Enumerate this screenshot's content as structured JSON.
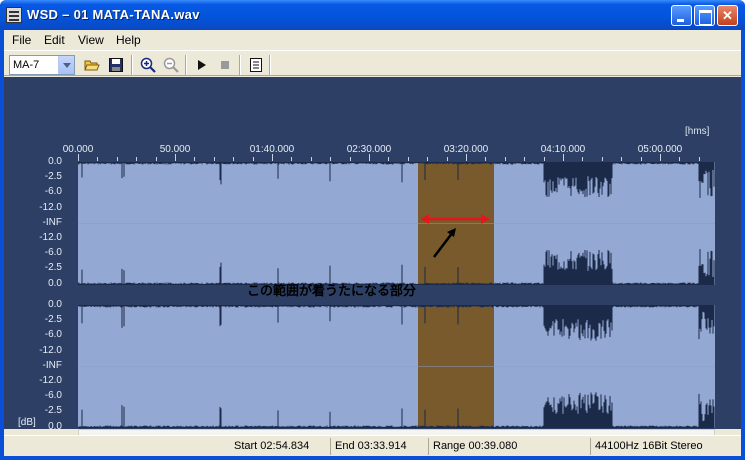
{
  "window": {
    "title": "WSD – 01 MATA-TANA.wav"
  },
  "menu": {
    "file": "File",
    "edit": "Edit",
    "view": "View",
    "help": "Help"
  },
  "toolbar": {
    "preset_value": "MA-7",
    "icons": [
      "open-folder-icon",
      "save-icon",
      "zoom-in-icon",
      "zoom-out-icon",
      "play-icon",
      "stop-icon",
      "properties-icon"
    ]
  },
  "waveform": {
    "time_unit": "[hms]",
    "time_labels": [
      "00.000",
      "50.000",
      "01:40.000",
      "02:30.000",
      "03:20.000",
      "04:10.000",
      "05:00.000"
    ],
    "db_labels_top": [
      "0.0",
      "-2.5",
      "-6.0",
      "-12.0",
      "-INF",
      "-12.0",
      "-6.0",
      "-2.5",
      "0.0"
    ],
    "db_labels_bottom": [
      "0.0",
      "-2.5",
      "-6.0",
      "-12.0",
      "-INF",
      "-12.0",
      "-6.0",
      "-2.5",
      "0.0"
    ],
    "db_unit": "[dB]",
    "annotation": "この範囲が着うたになる部分",
    "colors": {
      "background": "#2d3f64",
      "channel": "#94a8d4",
      "selection": "#795a2c",
      "wave": "#1b2a48",
      "arrow": "#e8141c"
    }
  },
  "status": {
    "start": "Start 02:54.834",
    "end": "End 03:33.914",
    "range": "Range 00:39.080",
    "format": "44100Hz 16Bit Stereo"
  }
}
